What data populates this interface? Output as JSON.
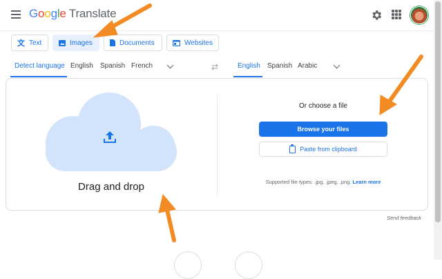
{
  "header": {
    "logo_parts": [
      "G",
      "o",
      "o",
      "g",
      "l",
      "e"
    ],
    "product": "Translate",
    "icons": [
      "menu-icon",
      "settings-icon",
      "apps-icon",
      "avatar"
    ]
  },
  "modes": [
    {
      "label": "Text",
      "icon": "translate-icon"
    },
    {
      "label": "Images",
      "icon": "image-icon",
      "active": true
    },
    {
      "label": "Documents",
      "icon": "document-icon"
    },
    {
      "label": "Websites",
      "icon": "website-icon"
    }
  ],
  "source_langs": [
    "Detect language",
    "English",
    "Spanish",
    "French"
  ],
  "target_langs": [
    "English",
    "Spanish",
    "Arabic"
  ],
  "upload": {
    "drag_text": "Drag and drop",
    "choose_title": "Or choose a file",
    "browse_label": "Browse your files",
    "paste_label": "Paste from clipboard",
    "supported_text": "Supported file types: .jpg, .jpeg, .png.",
    "learn_more": "Learn more"
  },
  "footer": {
    "feedback": "Send feedback"
  },
  "colors": {
    "accent": "#1a73e8",
    "cloud": "#d2e3fc",
    "annotation_arrow": "#f28b24"
  }
}
